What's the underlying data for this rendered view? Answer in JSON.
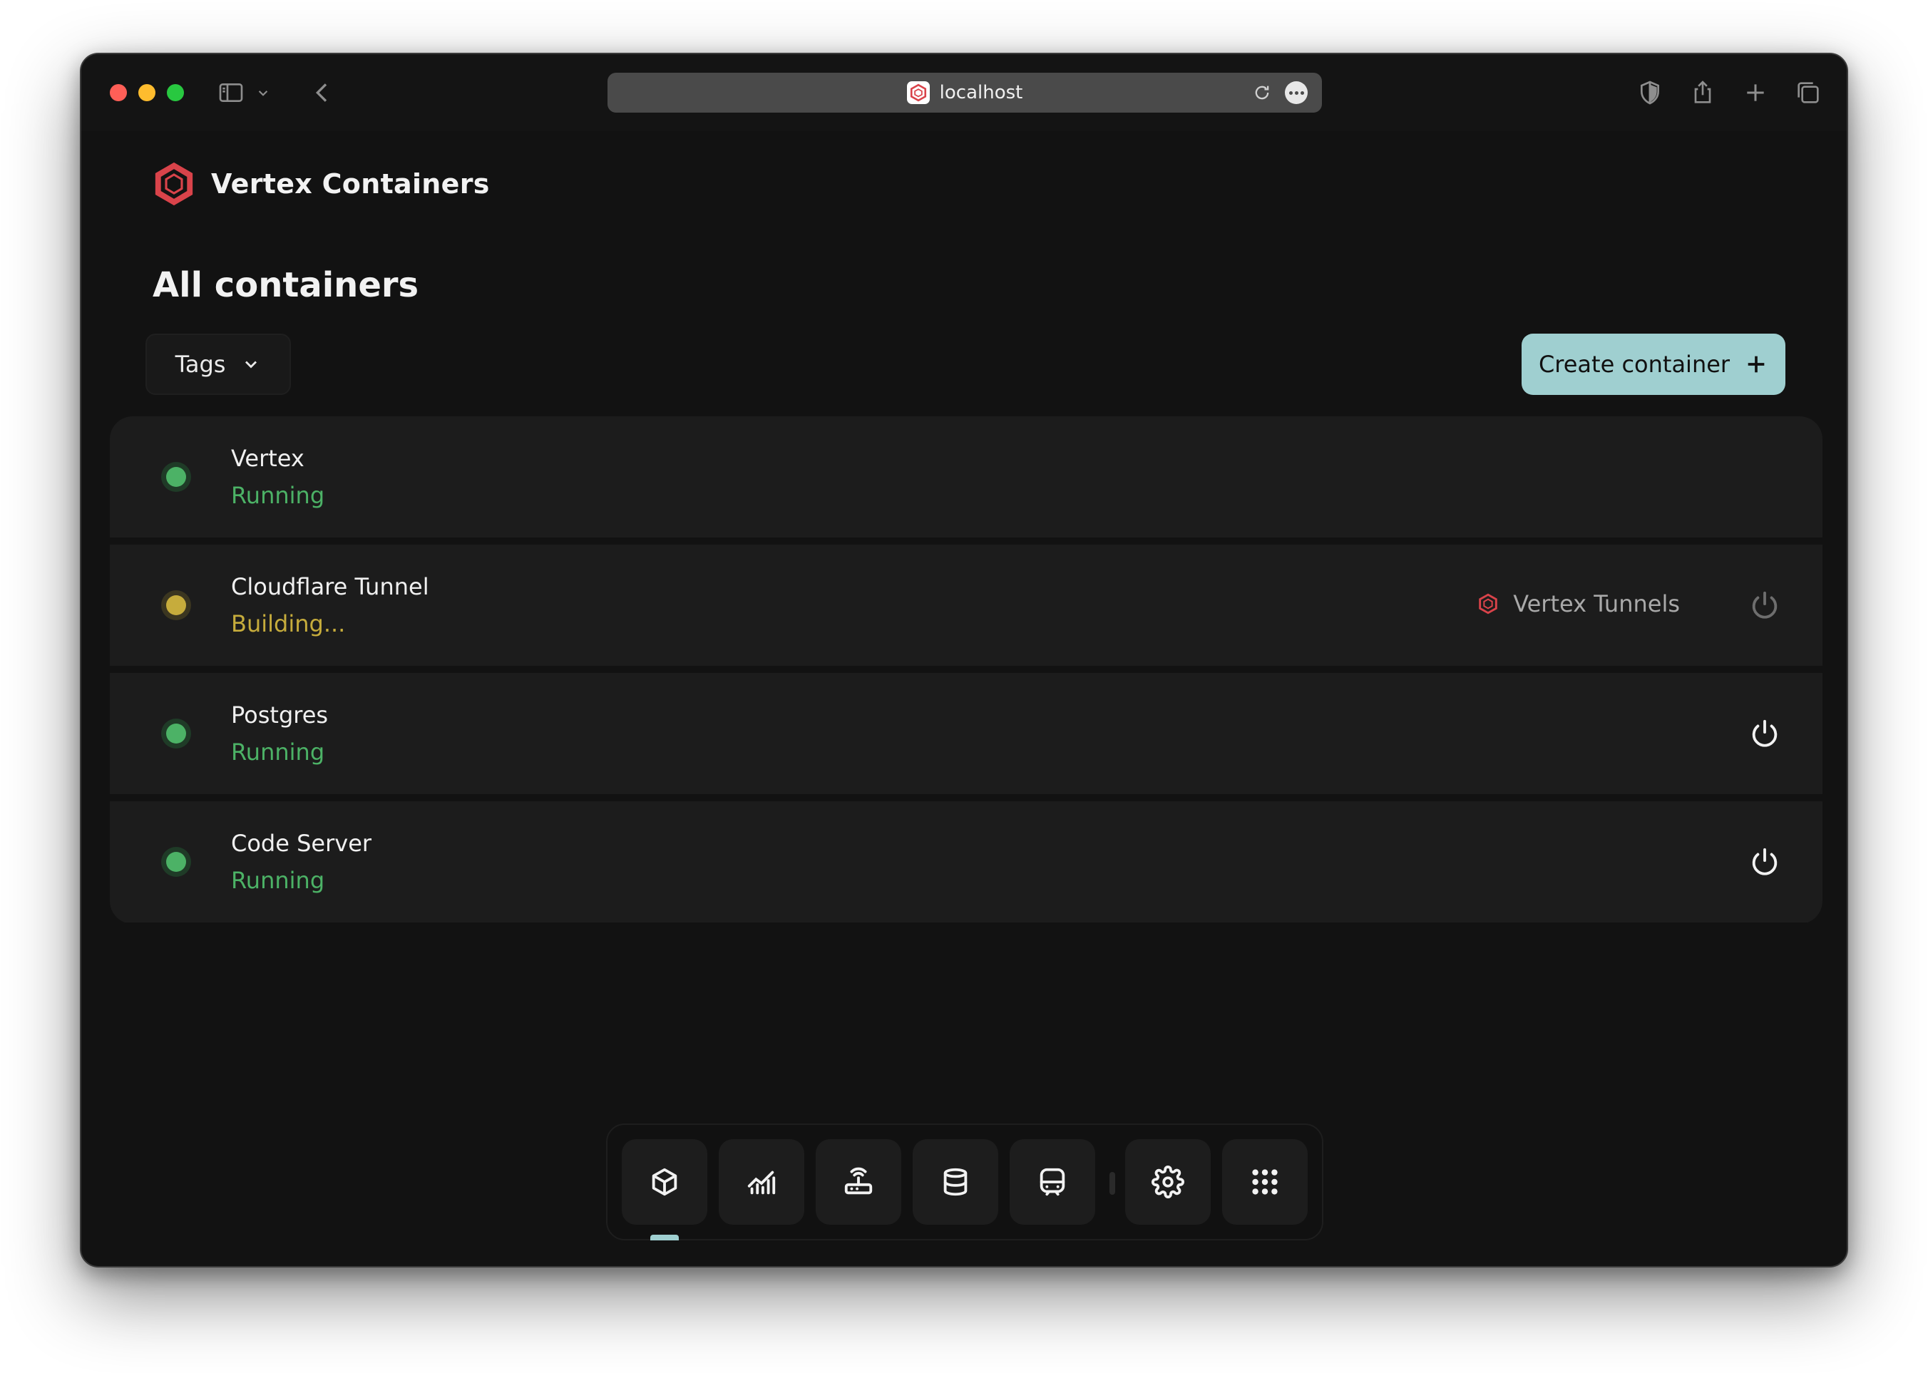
{
  "browser": {
    "url": "localhost"
  },
  "app": {
    "brand_name": "Vertex Containers",
    "page_title": "All containers",
    "tags_label": "Tags",
    "create_label": "Create container"
  },
  "containers": [
    {
      "name": "Vertex",
      "status": "Running",
      "state": "running",
      "power": false,
      "tag": ""
    },
    {
      "name": "Cloudflare Tunnel",
      "status": "Building...",
      "state": "building",
      "power": "disabled",
      "tag": "Vertex Tunnels"
    },
    {
      "name": "Postgres",
      "status": "Running",
      "state": "running",
      "power": true,
      "tag": ""
    },
    {
      "name": "Code Server",
      "status": "Running",
      "state": "running",
      "power": true,
      "tag": ""
    }
  ],
  "dock": {
    "items": [
      "containers-icon",
      "monitoring-icon",
      "network-icon",
      "database-icon",
      "tunnel-icon",
      "settings-icon",
      "apps-grid-icon"
    ],
    "active": "containers-icon"
  },
  "colors": {
    "accent": "#9fcfd0",
    "running": "#4cb266",
    "building": "#c6ac3c",
    "brand": "#d9434a",
    "background": "#121212"
  }
}
